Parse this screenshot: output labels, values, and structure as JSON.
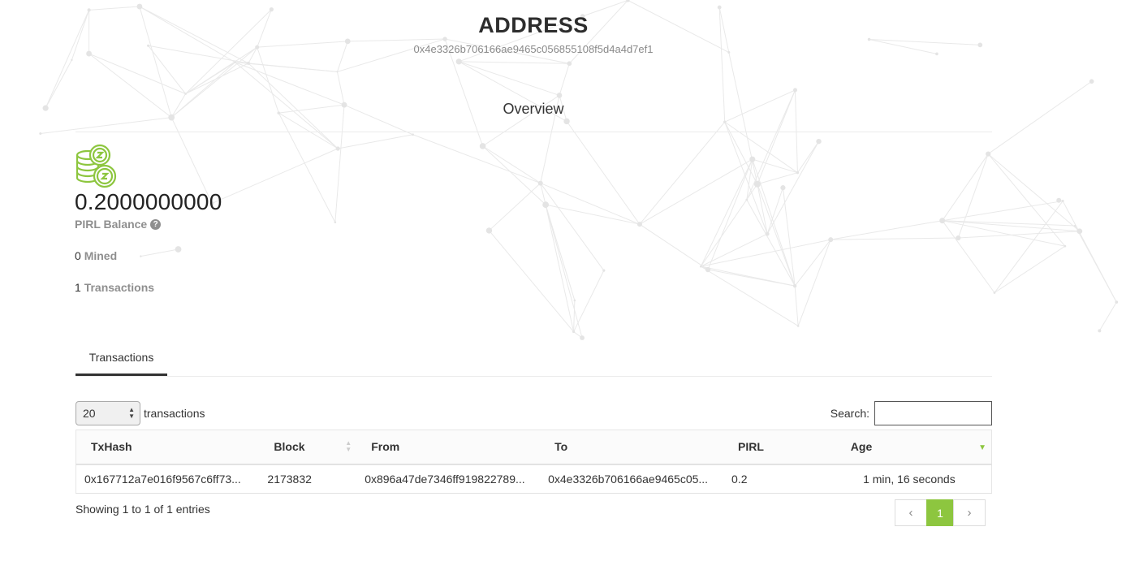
{
  "header": {
    "title": "ADDRESS",
    "address": "0x4e3326b706166ae9465c056855108f5d4a4d7ef1"
  },
  "overview": {
    "heading": "Overview",
    "icon": "coins-icon",
    "balance_value": "0.2000000000",
    "balance_label": "PIRL Balance",
    "help_icon": "question-circle-icon",
    "mined_count": "0",
    "mined_label": "Mined",
    "tx_count": "1",
    "tx_label": "Transactions"
  },
  "tabs": [
    {
      "label": "Transactions",
      "active": true
    }
  ],
  "table_controls": {
    "page_length": "20",
    "length_suffix": "transactions",
    "search_label": "Search:",
    "search_value": ""
  },
  "table": {
    "columns": [
      "TxHash",
      "Block",
      "From",
      "To",
      "PIRL",
      "Age"
    ],
    "sorted_column": "Age",
    "sort_direction": "desc",
    "rows": [
      [
        "0x167712a7e016f9567c6ff73...",
        "2173832",
        "0x896a47de7346ff919822789...",
        "0x4e3326b706166ae9465c05...",
        "0.2",
        "1 min, 16 seconds"
      ]
    ]
  },
  "footer": {
    "info": "Showing 1 to 1 of 1 entries",
    "prev": "‹",
    "current_page": "1",
    "next": "›"
  },
  "colors": {
    "accent": "#8dc63f",
    "text": "#333333",
    "muted": "#8f8f8f"
  }
}
